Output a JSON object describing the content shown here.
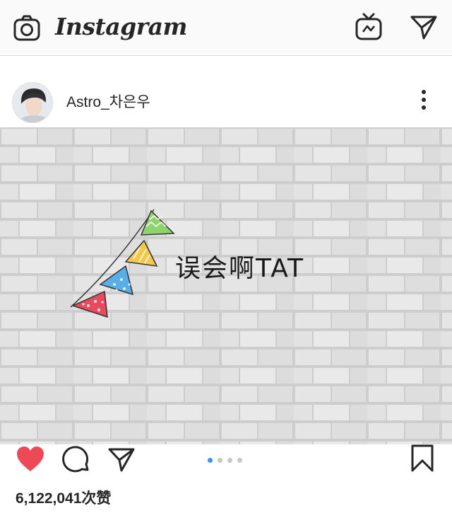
{
  "topbar": {
    "logo_text": "Instagram",
    "icons": [
      "camera-icon",
      "igtv-icon",
      "direct-message-icon"
    ]
  },
  "post": {
    "username": "Astro_차은우",
    "photo_caption": "误会啊TAT",
    "carousel": {
      "count": 4,
      "active_index": 0
    },
    "likes_text": "6,122,041次赞",
    "liked": true,
    "bunting_colors": [
      "#e84a5f",
      "#5aaee8",
      "#f6c84a",
      "#8fd36e"
    ]
  },
  "colors": {
    "like_red": "#ed4956",
    "accent_blue": "#3897f0",
    "wall_base": "#dcdcdc",
    "wall_mortar": "#c4c4c4"
  }
}
